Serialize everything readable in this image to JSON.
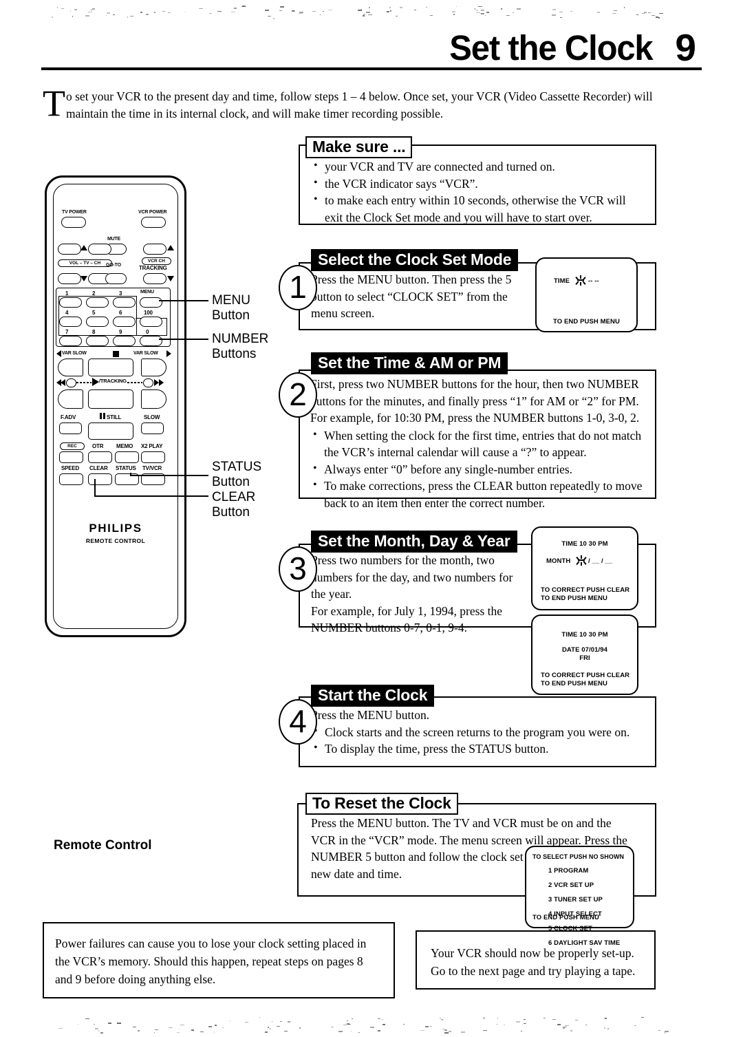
{
  "header": {
    "title": "Set the Clock",
    "page_number": "9"
  },
  "intro": {
    "dropcap": "T",
    "text": "o set your VCR to the present day and time, follow steps 1 – 4 below. Once set, your VCR (Video Cassette Recorder) will maintain the time in its internal clock, and will make timer recording possible."
  },
  "remote": {
    "caption": "Remote Control",
    "brand": "PHILIPS",
    "brand_sub": "REMOTE CONTROL",
    "labels": {
      "tv_power": "TV POWER",
      "vcr_power": "VCR POWER",
      "mute": "MUTE",
      "goto": "GO-TO",
      "vol_tv_ch": "VOL – TV – CH",
      "vcr_ch": "VCR CH",
      "tracking": "TRACKING",
      "menu": "MENU",
      "hundred": "100",
      "var_slow_left": "VAR SLOW",
      "var_slow_right": "VAR SLOW",
      "tracking_bar": "/TRACKING",
      "f_adv": "F.ADV",
      "still": "STILL",
      "slow": "SLOW",
      "rec": "REC",
      "otr": "OTR",
      "memo": "MEMO",
      "x2play": "X2 PLAY",
      "speed": "SPEED",
      "clear": "CLEAR",
      "status": "STATUS",
      "tvvcr": "TV/VCR"
    },
    "numbers": [
      "1",
      "2",
      "3",
      "4",
      "5",
      "6",
      "7",
      "8",
      "9",
      "0"
    ],
    "callouts": [
      {
        "line1": "MENU",
        "line2": "Button"
      },
      {
        "line1": "NUMBER",
        "line2": "Buttons"
      },
      {
        "line1": "STATUS",
        "line2": "Button"
      },
      {
        "line1": "CLEAR",
        "line2": "Button"
      }
    ]
  },
  "make_sure": {
    "title": "Make sure ...",
    "bullets": [
      "your VCR and TV are connected and turned on.",
      "the VCR indicator says “VCR”.",
      "to make each entry within 10 seconds, otherwise the VCR will exit the Clock Set mode and you will have to start over."
    ]
  },
  "step1": {
    "number": "1",
    "title": "Select the Clock Set Mode",
    "body": "Press the MENU button. Then press the 5 button to select “CLOCK SET” from the menu screen.",
    "screen": {
      "time_label": "TIME",
      "time_value": "-- --",
      "footer": "TO END PUSH MENU"
    }
  },
  "step2": {
    "number": "2",
    "title": "Set the Time & AM or PM",
    "body": "First, press two NUMBER buttons for the hour, then two NUMBER buttons for the minutes, and finally press “1” for AM or “2” for PM. For example, for 10:30 PM, press the NUMBER buttons 1-0, 3-0, 2.",
    "bullets": [
      "When setting the clock for the first time, entries that do not match the VCR’s internal calendar will cause a “?” to appear.",
      "Always enter “0” before any single-number entries.",
      "To make corrections, press the CLEAR button repeatedly to move back to an item then enter the correct number."
    ]
  },
  "step3": {
    "number": "3",
    "title": "Set the Month, Day & Year",
    "body_line1": "Press two numbers for the month, two numbers for the day, and two numbers for the year.",
    "body_line2": "For example, for July 1, 1994, press the NUMBER buttons 0-7, 0-1, 9-4.",
    "screen_a": {
      "time": "TIME 10 30 PM",
      "month_label": "MONTH",
      "month_value": "/ __ / __",
      "footer1": "TO CORRECT PUSH CLEAR",
      "footer2": "TO END PUSH MENU"
    },
    "screen_b": {
      "time": "TIME 10 30 PM",
      "date": "DATE 07/01/94",
      "day": "FRI",
      "footer1": "TO CORRECT PUSH CLEAR",
      "footer2": "TO END PUSH MENU"
    }
  },
  "step4": {
    "number": "4",
    "title": "Start the Clock",
    "body": "Press the MENU button.",
    "bullets": [
      "Clock starts and the screen returns to the program you were on.",
      "To display the time, press the STATUS button."
    ]
  },
  "reset": {
    "title": "To Reset the Clock",
    "body": "Press the MENU button. The TV and VCR must be on and the VCR in the “VCR” mode. The menu screen will appear. Press the NUMBER 5 button and follow the clock set guide to re-enter the new date and time.",
    "screen": {
      "header": "TO SELECT PUSH NO  SHOWN",
      "items": [
        "1 PROGRAM",
        "2 VCR SET UP",
        "3 TUNER SET UP",
        "4 INPUT SELECT",
        "5 CLOCK SET",
        "6 DAYLIGHT SAV  TIME"
      ],
      "footer": "TO END PUSH MENU"
    }
  },
  "note_left": {
    "text": "Power failures can cause you to lose your clock setting placed in the VCR’s memory. Should this happen, repeat steps on pages 8 and 9 before doing anything else."
  },
  "note_right": {
    "line1": "Your VCR should now be properly set-up.",
    "line2": "Go to the next page and try playing a tape."
  }
}
